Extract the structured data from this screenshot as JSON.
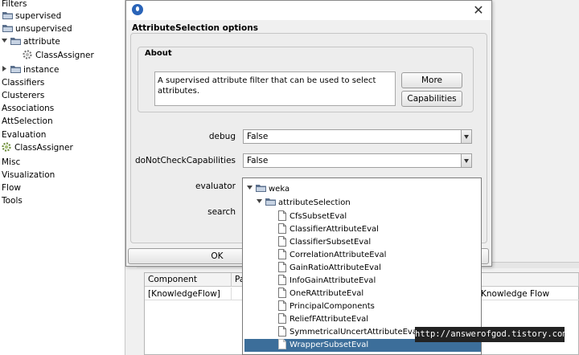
{
  "tree": {
    "items": [
      {
        "label": "Filters"
      },
      {
        "label": "supervised"
      },
      {
        "label": "unsupervised"
      },
      {
        "label": "attribute"
      },
      {
        "label": "ClassAssigner"
      },
      {
        "label": "instance"
      },
      {
        "label": "Classifiers"
      },
      {
        "label": "Clusterers"
      },
      {
        "label": "Associations"
      },
      {
        "label": "AttSelection"
      },
      {
        "label": "Evaluation"
      },
      {
        "label": "ClassAssigner"
      },
      {
        "label": "Misc"
      },
      {
        "label": "Visualization"
      },
      {
        "label": "Flow"
      },
      {
        "label": "Tools"
      }
    ]
  },
  "dialog": {
    "header": "AttributeSelection options",
    "about": {
      "title": "About",
      "text": "A supervised attribute filter that can be used to select attributes.",
      "more_label": "More",
      "capabilities_label": "Capabilities"
    },
    "props": {
      "debug": {
        "label": "debug",
        "value": "False"
      },
      "dncc": {
        "label": "doNotCheckCapabilities",
        "value": "False"
      },
      "evaluator": {
        "label": "evaluator"
      },
      "search": {
        "label": "search"
      }
    },
    "ok_label": "OK"
  },
  "popup": {
    "root": "weka",
    "package": "attributeSelection",
    "classes": [
      "CfsSubsetEval",
      "ClassifierAttributeEval",
      "ClassifierSubsetEval",
      "CorrelationAttributeEval",
      "GainRatioAttributeEval",
      "InfoGainAttributeEval",
      "OneRAttributeEval",
      "PrincipalComponents",
      "ReliefFAttributeEval",
      "SymmetricalUncertAttributeEval",
      "WrapperSubsetEval"
    ],
    "selected": "WrapperSubsetEval"
  },
  "table": {
    "headers": [
      "Component",
      "Pa"
    ],
    "row": {
      "component": "[KnowledgeFlow]",
      "right_text": "Knowledge Flow"
    }
  },
  "watermark": "http://answerofgod.tistory.com",
  "colors": {
    "selection": "#3c6e9a",
    "folder": "#5a6f8c"
  }
}
